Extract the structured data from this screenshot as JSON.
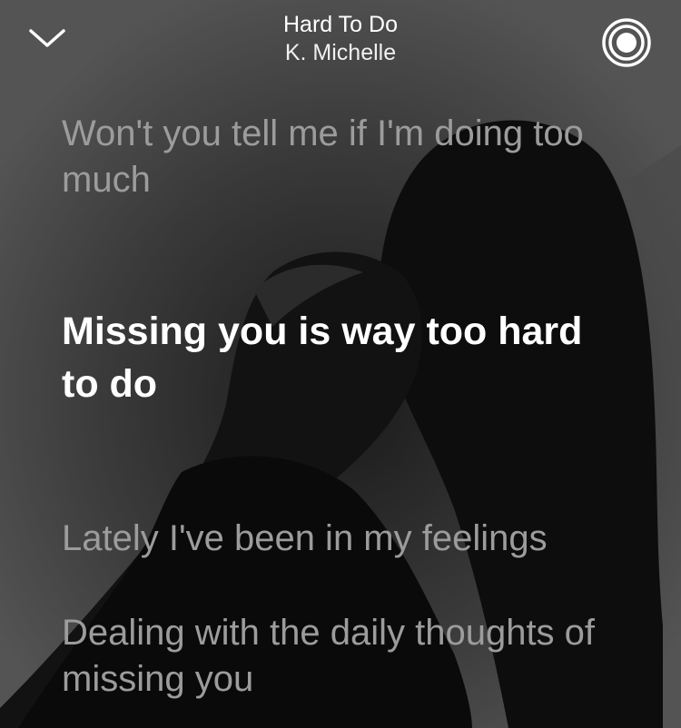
{
  "now_playing": {
    "title": "Hard To Do",
    "artist": "K. Michelle"
  },
  "icons": {
    "close": "chevron-down-icon",
    "airplay": "airplay-icon"
  },
  "lyrics": {
    "previous": "Won't you tell me if I'm doing too much",
    "current": "Missing you is way too hard to do",
    "next_1": "Lately I've been in my feelings",
    "next_2": "Dealing with the daily thoughts of missing you"
  },
  "colors": {
    "current_line": "#ffffff",
    "other_lines": "#9c9c9c"
  }
}
